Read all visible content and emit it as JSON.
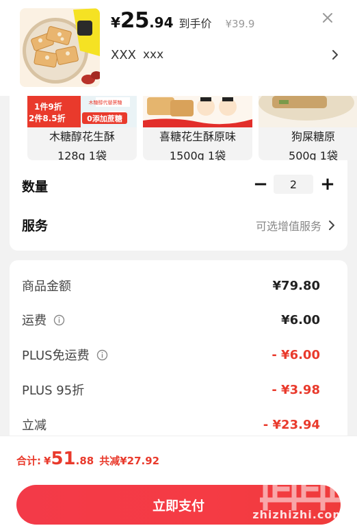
{
  "product": {
    "price_currency": "¥",
    "price_int": "25",
    "price_dec": ".94",
    "price_tag": "到手价",
    "orig_price": "¥39.9",
    "address_name": "XXX",
    "address_detail": "xxx"
  },
  "variants": [
    {
      "name": "木糖醇花生酥",
      "spec": "128g 1袋",
      "promo_1": "1件9折",
      "promo_2": "2件8.5折",
      "promo_3": "0添加蔗糖",
      "promo_4": "木糖醇代替蔗糖"
    },
    {
      "name": "喜糖花生酥原味",
      "spec": "1500g 1袋"
    },
    {
      "name": "狗屎糖原",
      "spec": "500g 1袋"
    }
  ],
  "quantity": {
    "label": "数量",
    "value": "2",
    "minus": "−",
    "plus": "+"
  },
  "service": {
    "label": "服务",
    "value": "可选增值服务"
  },
  "fees": [
    {
      "label": "商品金额",
      "amount": "¥79.80",
      "info": false,
      "red": false
    },
    {
      "label": "运费",
      "amount": "¥6.00",
      "info": true,
      "red": false
    },
    {
      "label": "PLUS免运费",
      "amount": "- ¥6.00",
      "info": true,
      "red": true
    },
    {
      "label": "PLUS 95折",
      "amount": "- ¥3.98",
      "info": false,
      "red": true
    },
    {
      "label": "立减",
      "amount": "- ¥23.94",
      "info": false,
      "red": true
    }
  ],
  "footer": {
    "total_label": "合计:",
    "total_cur": "¥",
    "total_int": "51",
    "total_dec": ".88",
    "saved": "共减¥27.92",
    "pay_label": "立即支付"
  },
  "watermark": {
    "text": "zhizhizhi.com",
    "glyph": "值值值"
  },
  "colors": {
    "accent_red": "#e93a2c",
    "button_red": "#f33a48"
  }
}
